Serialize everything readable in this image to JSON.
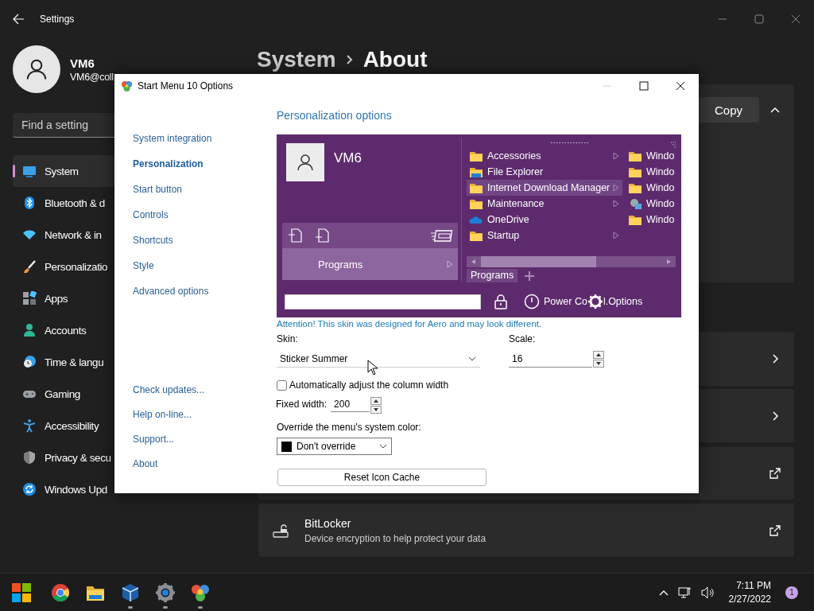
{
  "settings": {
    "title": "Settings",
    "user": {
      "name": "VM6",
      "email": "VM6@coll"
    },
    "search": {
      "placeholder": "Find a setting"
    },
    "nav": [
      {
        "label": "System",
        "selected": true
      },
      {
        "label": "Bluetooth & d",
        "selected": false
      },
      {
        "label": "Network & in",
        "selected": false
      },
      {
        "label": "Personalizatio",
        "selected": false
      },
      {
        "label": "Apps",
        "selected": false
      },
      {
        "label": "Accounts",
        "selected": false
      },
      {
        "label": "Time & langu",
        "selected": false
      },
      {
        "label": "Gaming",
        "selected": false
      },
      {
        "label": "Accessibility",
        "selected": false
      },
      {
        "label": "Privacy & secu",
        "selected": false
      },
      {
        "label": "Windows Upd",
        "selected": false
      }
    ],
    "breadcrumb": [
      "System",
      "About"
    ],
    "cards": [
      {
        "kind": "expander",
        "expanded": true,
        "button": "Copy"
      },
      {
        "kind": "navigation"
      },
      {
        "kind": "navigation"
      },
      {
        "kind": "external"
      },
      {
        "kind": "external",
        "title": "BitLocker",
        "subtitle": "Device encryption to help protect your data"
      }
    ]
  },
  "dialog": {
    "title": "Start Menu 10 Options",
    "nav": [
      {
        "label": "System integration",
        "selected": false
      },
      {
        "label": "Personalization",
        "selected": true
      },
      {
        "label": "Start button",
        "selected": false
      },
      {
        "label": "Controls",
        "selected": false
      },
      {
        "label": "Shortcuts",
        "selected": false
      },
      {
        "label": "Style",
        "selected": false
      },
      {
        "label": "Advanced options",
        "selected": false
      }
    ],
    "nav_footer": [
      "Check updates...",
      "Help on-line...",
      "Support...",
      "About"
    ],
    "heading": "Personalization options",
    "preview": {
      "user": "VM6",
      "programs_button": "Programs",
      "menu_items": [
        {
          "label": "Accessories",
          "submenu": true,
          "selected": false
        },
        {
          "label": "File Explorer",
          "submenu": false,
          "selected": false
        },
        {
          "label": "Internet Download Manager",
          "submenu": true,
          "selected": true
        },
        {
          "label": "Maintenance",
          "submenu": true,
          "selected": false
        },
        {
          "label": "OneDrive",
          "submenu": false,
          "selected": false
        },
        {
          "label": "Startup",
          "submenu": true,
          "selected": false
        }
      ],
      "column_2": [
        "Windo",
        "Windo",
        "Windo",
        "Windo",
        "Windo"
      ],
      "tab": "Programs",
      "power_label": "Power Co",
      "options_label": "l.Options"
    },
    "notice": "Attention! This skin was designed for Aero and may look different.",
    "skin": {
      "label": "Skin:",
      "value": "Sticker Summer"
    },
    "scale": {
      "label": "Scale:",
      "value": "16"
    },
    "auto_width": {
      "label": "Automatically adjust the column width",
      "checked": false
    },
    "fixed_width": {
      "label": "Fixed width:",
      "value": "200"
    },
    "override_color": {
      "label": "Override the menu's system color:",
      "value": "Don't override"
    },
    "reset_button": "Reset Icon Cache"
  },
  "taskbar": {
    "apps": [
      {
        "running": false
      },
      {
        "running": false
      },
      {
        "running": false
      },
      {
        "running": true
      },
      {
        "running": true
      },
      {
        "running": true
      }
    ],
    "time": "7:11 PM",
    "date": "2/27/2022",
    "notifications": "1"
  }
}
